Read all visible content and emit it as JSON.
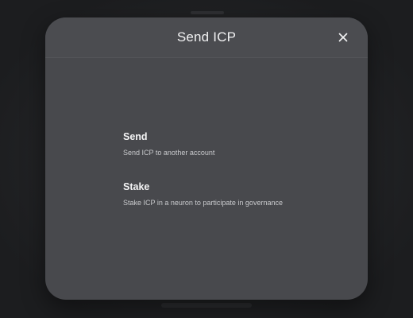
{
  "modal": {
    "title": "Send ICP",
    "close_icon": "close-icon",
    "options": [
      {
        "title": "Send",
        "description": "Send ICP to another account"
      },
      {
        "title": "Stake",
        "description": "Stake ICP in a neuron to participate in governance"
      }
    ]
  },
  "colors": {
    "backdrop": "#1f2022",
    "modal_background": "#48494d",
    "text_primary": "#f4f4f5",
    "text_secondary": "#c9cacd"
  }
}
